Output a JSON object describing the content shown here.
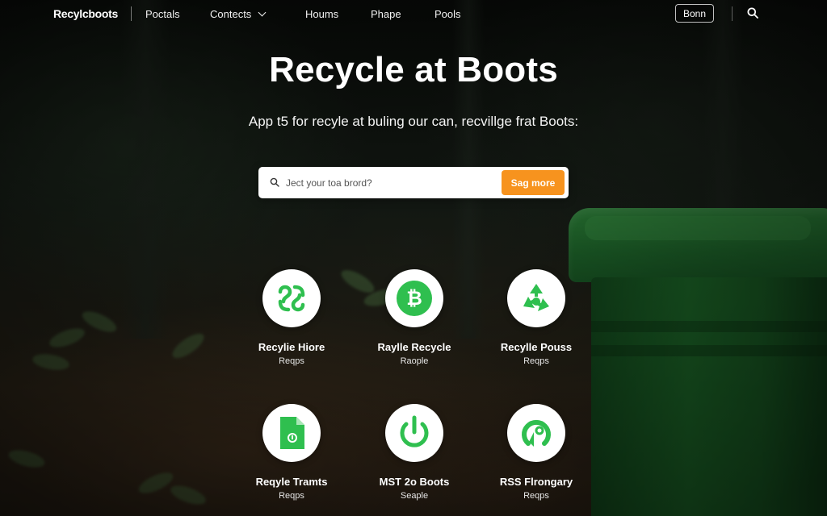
{
  "nav": {
    "brand": "Recylcboots",
    "links": [
      "Poctals",
      "Contects",
      "Houms",
      "Phape",
      "Pools"
    ],
    "button_label": "Bonn",
    "icons": {
      "search": "search-icon",
      "dropdown": "chevron-down-icon"
    }
  },
  "hero": {
    "title": "Recycle at Boots",
    "subtitle": "App t5 for recyle at buling our can, recvillge frat Boots:"
  },
  "search": {
    "placeholder": "Ject your toa brord?",
    "button_label": "Sag more"
  },
  "features": [
    {
      "title": "Recylie Hiore",
      "subtitle": "Reqps",
      "icon": "recycle-swirl-icon"
    },
    {
      "title": "Raylle Recycle",
      "subtitle": "Raople",
      "icon": "bitcoin-coin-icon"
    },
    {
      "title": "Recylle Pouss",
      "subtitle": "Reqps",
      "icon": "recycle-arrows-icon"
    },
    {
      "title": "Reqyle Tramts",
      "subtitle": "Reqps",
      "icon": "document-icon"
    },
    {
      "title": "MST 2o Boots",
      "subtitle": "Seaple",
      "icon": "power-icon"
    },
    {
      "title": "RSS Flrongary",
      "subtitle": "Reqps",
      "icon": "refresh-arrow-icon"
    }
  ],
  "colors": {
    "accent": "#f7931e",
    "icon_green": "#2fbf4f",
    "bin_green": "#1f6a2c"
  }
}
